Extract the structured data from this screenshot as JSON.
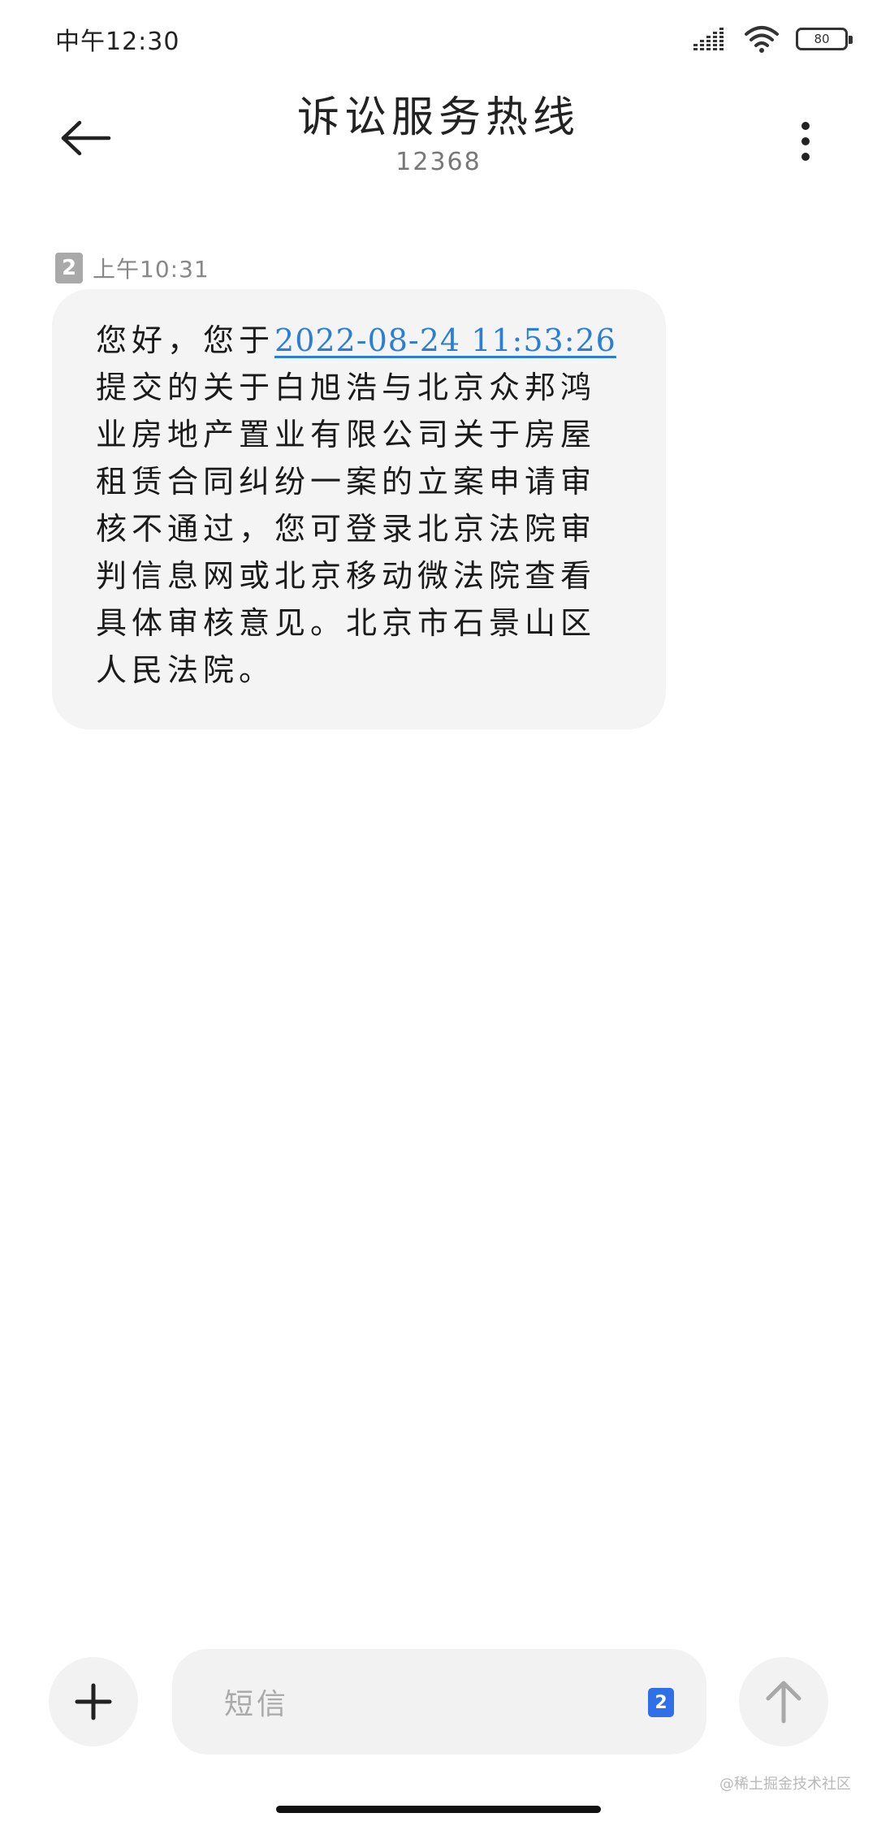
{
  "status_bar": {
    "time": "中午12:30",
    "battery": "80",
    "icons": [
      "signal-icon",
      "wifi-icon",
      "battery-icon"
    ]
  },
  "header": {
    "title": "诉讼服务热线",
    "subtitle": "12368",
    "icons": [
      "arrow-left-icon",
      "more-vertical-icon"
    ]
  },
  "message": {
    "sim": "2",
    "time": "上午10:31",
    "text_before": "您好，您于",
    "link": "2022-08-24 11:53:26",
    "text_after": "提交的关于白旭浩与北京众邦鸿业房地产置业有限公司关于房屋租赁合同纠纷一案的立案申请审核不通过，您可登录北京法院审判信息网或北京移动微法院查看具体审核意见。北京市石景山区人民法院。"
  },
  "input_bar": {
    "placeholder": "短信",
    "sim": "2",
    "icons": [
      "plus-icon",
      "arrow-up-icon"
    ]
  },
  "watermark": "@稀土掘金技术社区",
  "colors": {
    "link": "#2a7fd4",
    "bubble": "#f4f4f4",
    "sim_badge_active": "#2f6fe8",
    "sim_badge": "#a9a9a9"
  }
}
